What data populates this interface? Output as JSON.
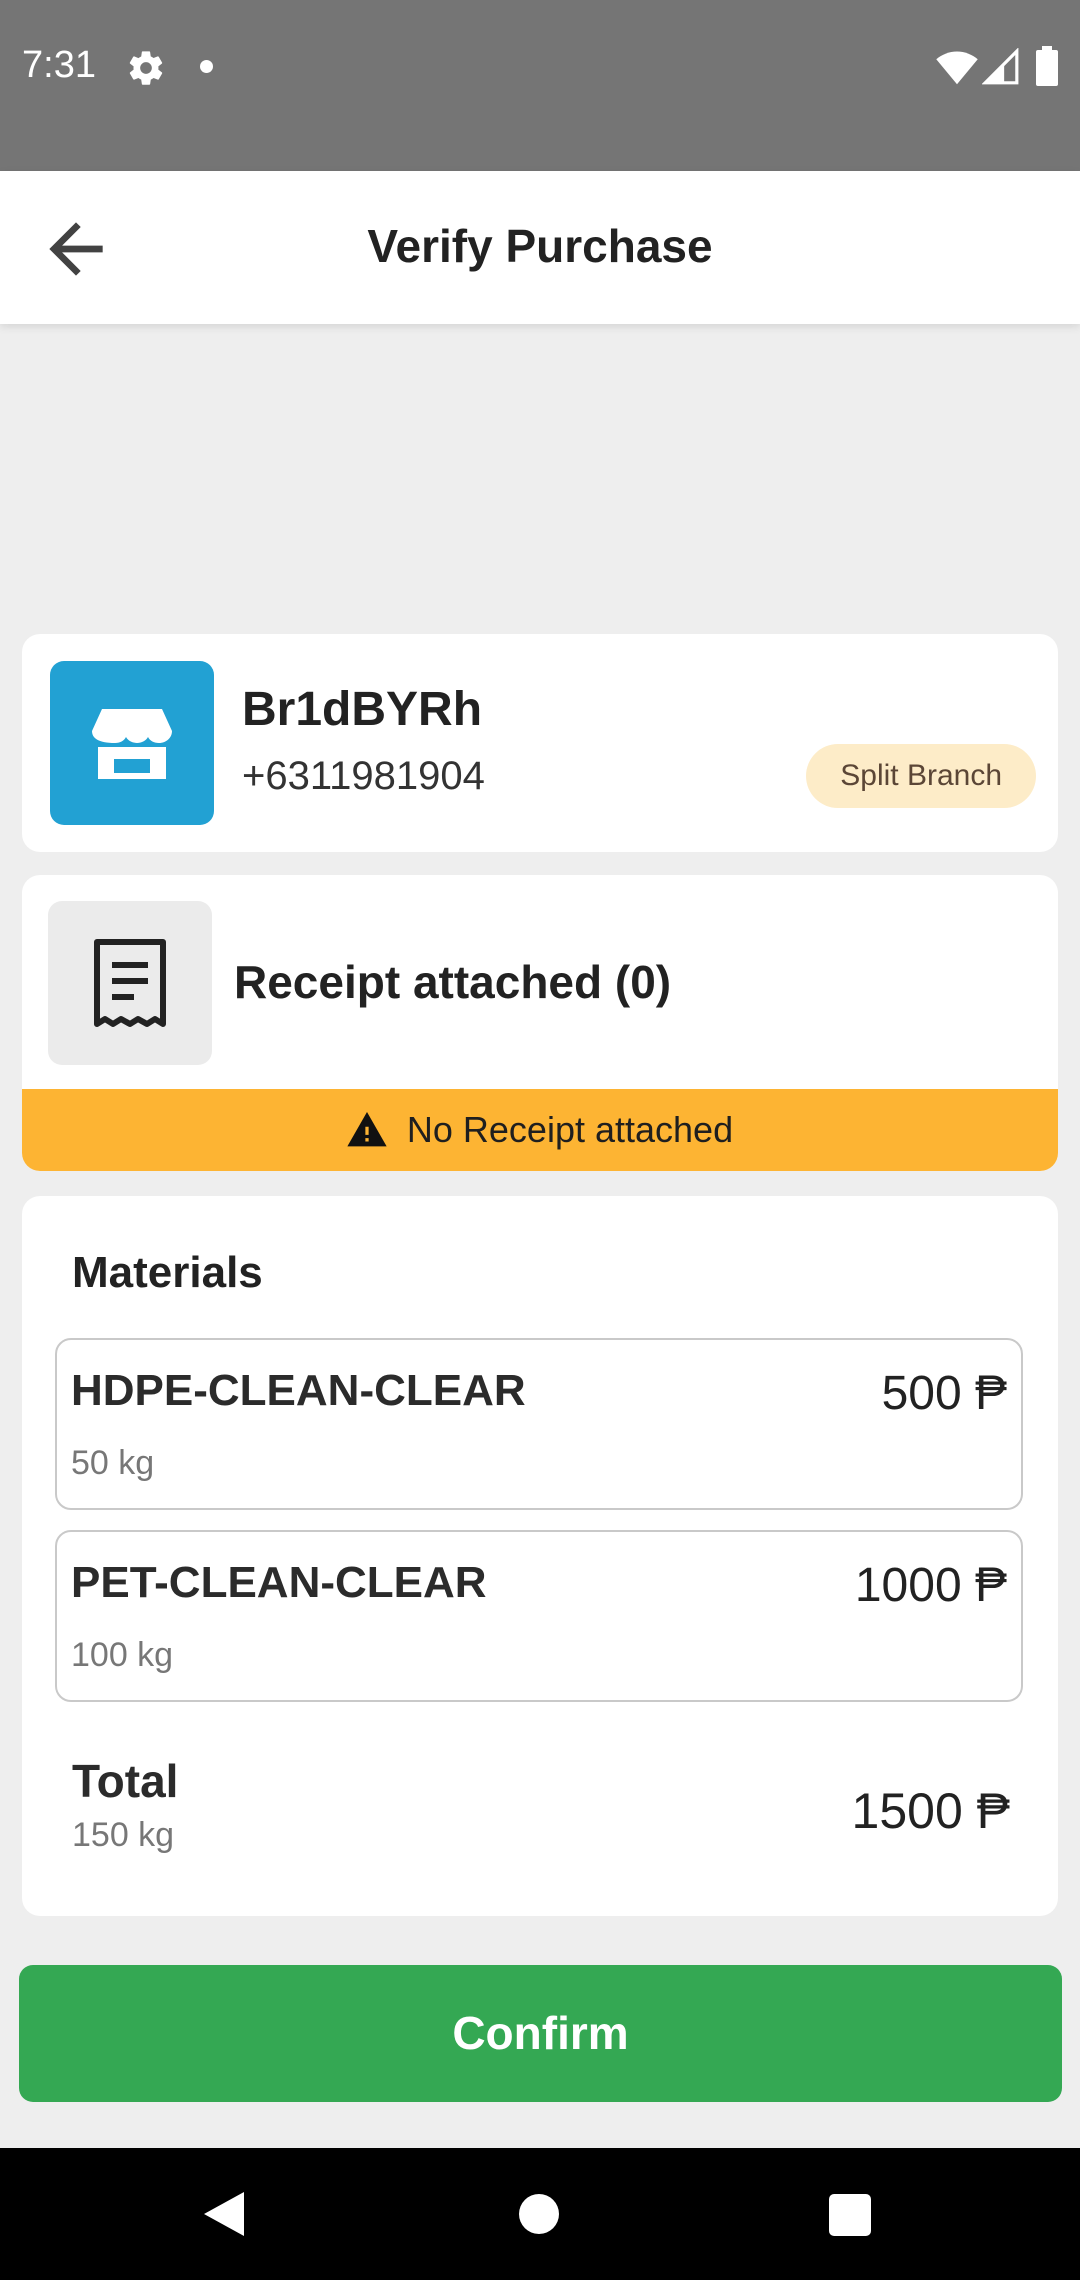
{
  "status_bar": {
    "time": "7:31",
    "icons": [
      "gear-icon",
      "notification-dot-icon",
      "wifi-icon",
      "signal-icon",
      "battery-icon"
    ]
  },
  "app_bar": {
    "title": "Verify Purchase",
    "back_icon": "arrow-left-icon"
  },
  "store": {
    "name": "Br1dBYRh",
    "phone": "+6311981904",
    "badge": "Split Branch",
    "icon": "store-icon",
    "icon_color": "#22a1d3",
    "badge_color": "#fdecc8"
  },
  "receipt": {
    "label": "Receipt attached (0)",
    "icon": "receipt-icon",
    "warning": "No Receipt attached",
    "warning_icon": "warning-icon",
    "warning_color": "#fdb433"
  },
  "materials": {
    "heading": "Materials",
    "items": [
      {
        "name": "HDPE-CLEAN-CLEAR",
        "weight": "50 kg",
        "price": "500 ₱"
      },
      {
        "name": "PET-CLEAN-CLEAR",
        "weight": "100 kg",
        "price": "1000 ₱"
      }
    ],
    "total": {
      "label": "Total",
      "weight": "150 kg",
      "price": "1500 ₱"
    }
  },
  "confirm": {
    "label": "Confirm",
    "color": "#34a853"
  },
  "nav_bar": {
    "icons": [
      "nav-back-icon",
      "nav-home-icon",
      "nav-recents-icon"
    ]
  }
}
